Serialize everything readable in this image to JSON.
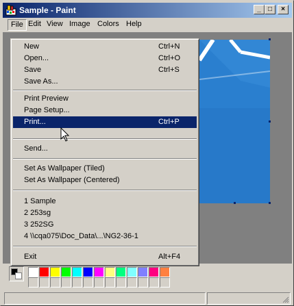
{
  "window": {
    "title": "Sample - Paint"
  },
  "title_buttons": {
    "minimize": "_",
    "maximize": "□",
    "close": "×"
  },
  "menubar": {
    "items": [
      {
        "label": "File"
      },
      {
        "label": "Edit"
      },
      {
        "label": "View"
      },
      {
        "label": "Image"
      },
      {
        "label": "Colors"
      },
      {
        "label": "Help"
      }
    ]
  },
  "file_menu": {
    "groups": [
      [
        {
          "label": "New",
          "shortcut": "Ctrl+N"
        },
        {
          "label": "Open...",
          "shortcut": "Ctrl+O"
        },
        {
          "label": "Save",
          "shortcut": "Ctrl+S"
        },
        {
          "label": "Save As...",
          "shortcut": ""
        }
      ],
      [
        {
          "label": "Print Preview",
          "shortcut": ""
        },
        {
          "label": "Page Setup...",
          "shortcut": ""
        },
        {
          "label": "Print...",
          "shortcut": "Ctrl+P",
          "highlighted": true
        }
      ],
      [
        {
          "label": "Send...",
          "shortcut": ""
        }
      ],
      [
        {
          "label": "Set As Wallpaper (Tiled)",
          "shortcut": ""
        },
        {
          "label": "Set As Wallpaper (Centered)",
          "shortcut": ""
        }
      ],
      [
        {
          "label": "1 Sample",
          "shortcut": ""
        },
        {
          "label": "2 253sg",
          "shortcut": ""
        },
        {
          "label": "3 252SG",
          "shortcut": ""
        },
        {
          "label": "4 \\\\cqa075\\Doc_Data\\...\\NG2-36-1",
          "shortcut": ""
        }
      ],
      [
        {
          "label": "Exit",
          "shortcut": "Alt+F4"
        }
      ]
    ]
  },
  "palette": {
    "colors": [
      "#ffffff",
      "#ff0000",
      "#ffff00",
      "#00ff00",
      "#00ffff",
      "#0000ff",
      "#ff00ff",
      "#ffff80",
      "#00ff80",
      "#80ffff",
      "#8080ff",
      "#ff0080",
      "#ff8040"
    ],
    "foreground": "#000000",
    "background": "#ffffff"
  },
  "colors": {
    "titlebar_start": "#0a246a",
    "titlebar_end": "#a6caf0",
    "highlight": "#0a246a",
    "canvas_blue": "#2a7fcf"
  }
}
